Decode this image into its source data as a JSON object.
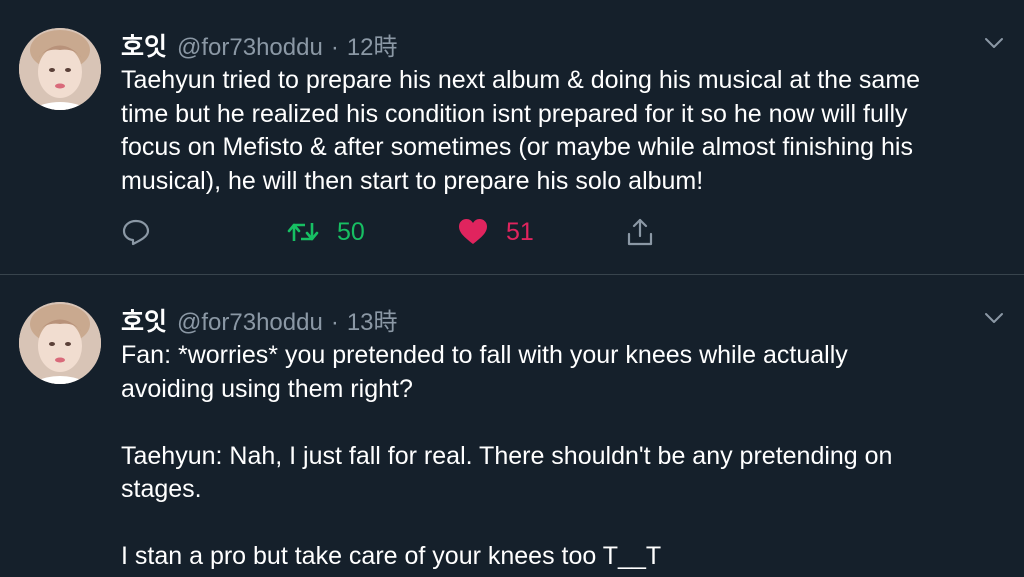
{
  "colors": {
    "background": "#15202b",
    "text": "#ffffff",
    "muted": "#8b98a5",
    "retweet_active": "#17bf63",
    "like_active": "#e0245e",
    "divider": "#38444d"
  },
  "tweets": [
    {
      "author": {
        "display_name": "호잇",
        "handle": "@for73hoddu"
      },
      "separator": "·",
      "time": "12時",
      "text_lines": [
        "Taehyun tried to prepare his next album & doing his musical at the same",
        "time but he realized his condition isnt prepared for it so he now will fully",
        "focus on Mefisto & after sometimes (or maybe while almost finishing his",
        "musical), he will then start to prepare his solo album!"
      ],
      "actions": {
        "reply_icon": "reply-icon",
        "retweet_icon": "retweet-icon",
        "retweet_count": "50",
        "like_icon": "heart-icon",
        "like_count": "51",
        "share_icon": "share-icon"
      }
    },
    {
      "author": {
        "display_name": "호잇",
        "handle": "@for73hoddu"
      },
      "separator": "·",
      "time": "13時",
      "paragraphs": [
        [
          "Fan: *worries* you pretended to fall with your knees while actually",
          "avoiding using them right?"
        ],
        [
          "Taehyun: Nah, I just fall for real. There shouldn't be any pretending on",
          "stages."
        ],
        [
          "I stan a pro but take care of your knees too T__T"
        ]
      ]
    }
  ]
}
